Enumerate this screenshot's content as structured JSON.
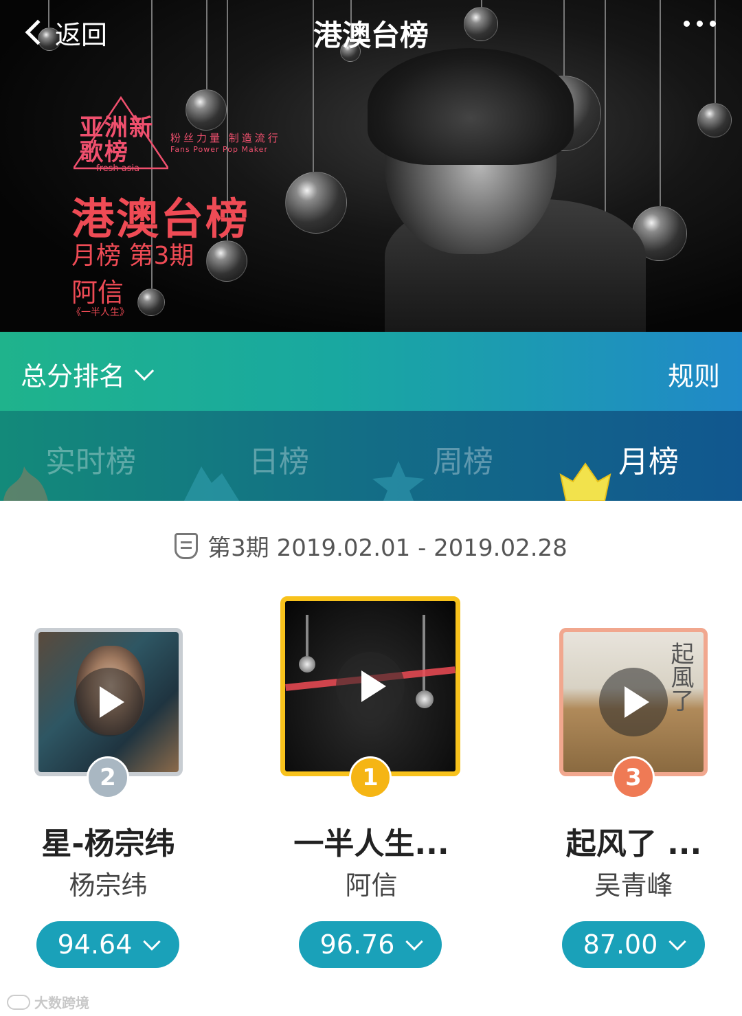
{
  "header": {
    "back_label": "返回",
    "title": "港澳台榜",
    "more_icon": "more-dots-icon"
  },
  "banner": {
    "logo_text": "亚洲新歌榜",
    "logo_sub": "fresh asia",
    "slogan_cn": "粉丝力量 制造流行",
    "slogan_en": "Fans Power  Pop Maker",
    "chart_name": "港澳台榜",
    "issue": "月榜 第3期",
    "artist": "阿信",
    "song": "《一半人生》"
  },
  "sortbar": {
    "sort_label": "总分排名",
    "rules_label": "规则"
  },
  "tabs": [
    {
      "label": "实时榜",
      "active": false
    },
    {
      "label": "日榜",
      "active": false
    },
    {
      "label": "周榜",
      "active": false
    },
    {
      "label": "月榜",
      "active": true
    }
  ],
  "period": {
    "text": "第3期 2019.02.01 - 2019.02.28"
  },
  "podium": [
    {
      "rank": "2",
      "song": "星-杨宗纬",
      "artist": "杨宗纬",
      "score": "94.64",
      "medal_color": "#a9b7c2",
      "frame_color": "#c8cdd2"
    },
    {
      "rank": "1",
      "song": "一半人生...",
      "artist": "阿信",
      "score": "96.76",
      "medal_color": "#f5b514",
      "frame_color": "#f8c21c"
    },
    {
      "rank": "3",
      "song": "起风了 ...",
      "artist": "吴青峰",
      "score": "87.00",
      "medal_color": "#ef7a55",
      "frame_color": "#f1a78e"
    }
  ],
  "watermark": "大数跨境",
  "colors": {
    "accent": "#1aa1b9",
    "banner_red": "#ef4b55",
    "gold": "#f8c21c"
  }
}
